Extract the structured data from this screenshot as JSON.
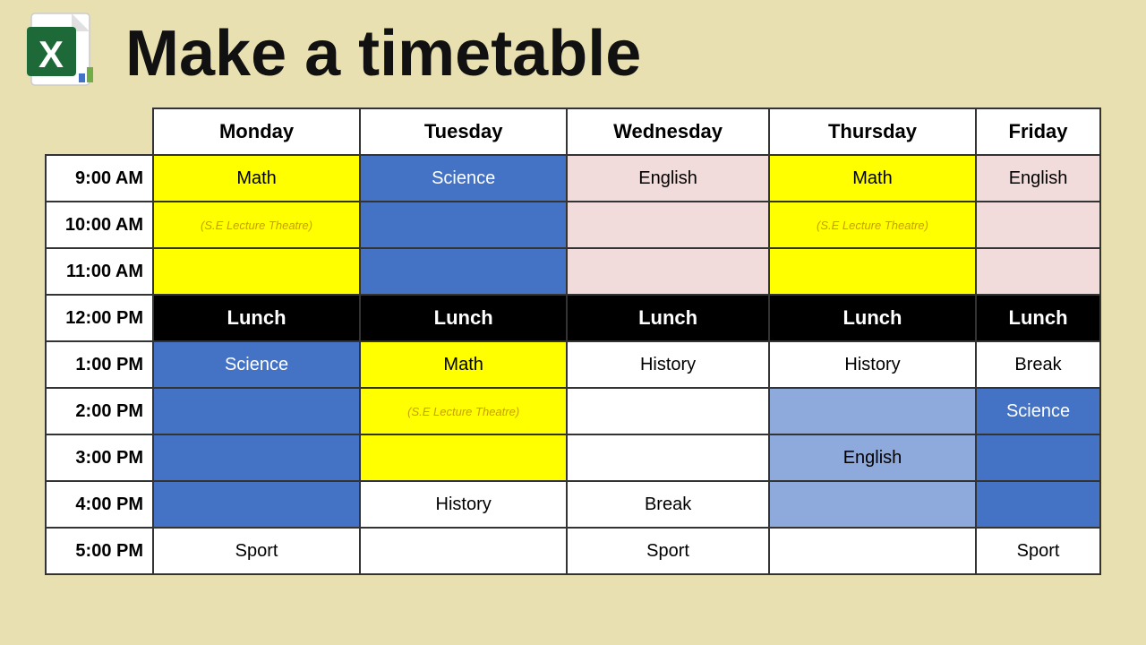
{
  "title": "Make a timetable",
  "header": {
    "days": [
      "Monday",
      "Tuesday",
      "Wednesday",
      "Thursday",
      "Friday"
    ]
  },
  "rows": [
    {
      "time": "9:00 AM",
      "cells": [
        {
          "text": "Math",
          "style": "yellow"
        },
        {
          "text": "Science",
          "style": "blue"
        },
        {
          "text": "English",
          "style": "pink"
        },
        {
          "text": "Math",
          "style": "yellow"
        },
        {
          "text": "English",
          "style": "pink"
        }
      ]
    },
    {
      "time": "10:00 AM",
      "cells": [
        {
          "text": "(S.E Lecture Theatre)",
          "style": "yellow",
          "sub": true
        },
        {
          "text": "",
          "style": "blue"
        },
        {
          "text": "",
          "style": "pink"
        },
        {
          "text": "(S.E Lecture Theatre)",
          "style": "yellow",
          "sub": true
        },
        {
          "text": "",
          "style": "pink"
        }
      ]
    },
    {
      "time": "11:00 AM",
      "cells": [
        {
          "text": "",
          "style": "yellow"
        },
        {
          "text": "",
          "style": "blue"
        },
        {
          "text": "",
          "style": "pink"
        },
        {
          "text": "",
          "style": "yellow"
        },
        {
          "text": "",
          "style": "pink"
        }
      ]
    },
    {
      "time": "12:00 PM",
      "cells": [
        {
          "text": "Lunch",
          "style": "black-row"
        },
        {
          "text": "Lunch",
          "style": "black-row"
        },
        {
          "text": "Lunch",
          "style": "black-row"
        },
        {
          "text": "Lunch",
          "style": "black-row"
        },
        {
          "text": "Lunch",
          "style": "black-row"
        }
      ]
    },
    {
      "time": "1:00 PM",
      "cells": [
        {
          "text": "Science",
          "style": "blue"
        },
        {
          "text": "Math",
          "style": "yellow"
        },
        {
          "text": "History",
          "style": "white"
        },
        {
          "text": "History",
          "style": "white"
        },
        {
          "text": "Break",
          "style": "white"
        }
      ]
    },
    {
      "time": "2:00 PM",
      "cells": [
        {
          "text": "",
          "style": "blue"
        },
        {
          "text": "(S.E Lecture Theatre)",
          "style": "yellow",
          "sub": true
        },
        {
          "text": "",
          "style": "white"
        },
        {
          "text": "",
          "style": "bluelight"
        },
        {
          "text": "Science",
          "style": "blue"
        }
      ]
    },
    {
      "time": "3:00 PM",
      "cells": [
        {
          "text": "",
          "style": "blue"
        },
        {
          "text": "",
          "style": "yellow"
        },
        {
          "text": "",
          "style": "white"
        },
        {
          "text": "English",
          "style": "bluelight"
        },
        {
          "text": "",
          "style": "blue"
        }
      ]
    },
    {
      "time": "4:00 PM",
      "cells": [
        {
          "text": "",
          "style": "blue"
        },
        {
          "text": "History",
          "style": "white"
        },
        {
          "text": "Break",
          "style": "white"
        },
        {
          "text": "",
          "style": "bluelight"
        },
        {
          "text": "",
          "style": "blue"
        }
      ]
    },
    {
      "time": "5:00 PM",
      "cells": [
        {
          "text": "Sport",
          "style": "white"
        },
        {
          "text": "",
          "style": "white"
        },
        {
          "text": "Sport",
          "style": "white"
        },
        {
          "text": "",
          "style": "white"
        },
        {
          "text": "Sport",
          "style": "white"
        }
      ]
    }
  ]
}
